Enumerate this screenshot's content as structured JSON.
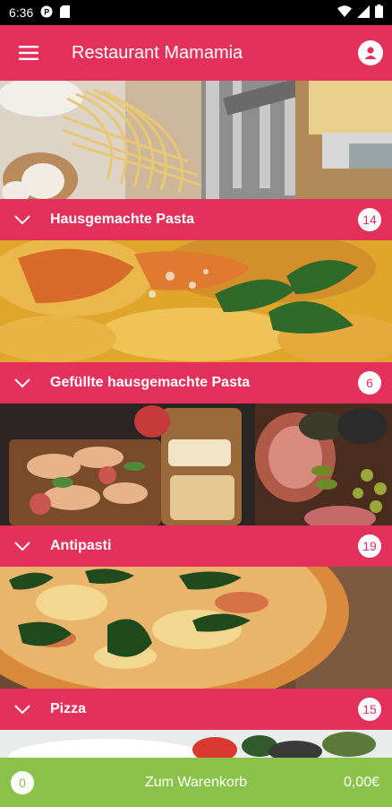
{
  "status_bar": {
    "time": "6:36",
    "left_icons": [
      "notification-p-icon",
      "sd-card-icon"
    ],
    "right_icons": [
      "wifi-icon",
      "signal-icon",
      "battery-icon"
    ]
  },
  "app_bar": {
    "title": "Restaurant Mamamia",
    "menu_icon": "hamburger-menu-icon",
    "profile_icon": "account-icon"
  },
  "categories": [
    {
      "label": "Hausgemachte Pasta",
      "count": "14",
      "image": "fresh-pasta-photo"
    },
    {
      "label": "Gefüllte hausgemachte Pasta",
      "count": "6",
      "image": "ravioli-photo"
    },
    {
      "label": "Antipasti",
      "count": "19",
      "image": "antipasti-platter-photo"
    },
    {
      "label": "Pizza",
      "count": "15",
      "image": "pizza-photo"
    }
  ],
  "cart": {
    "count": "0",
    "label": "Zum Warenkorb",
    "total": "0,00€"
  },
  "colors": {
    "accent": "#e4315c",
    "cart_green": "#8bc34a"
  }
}
